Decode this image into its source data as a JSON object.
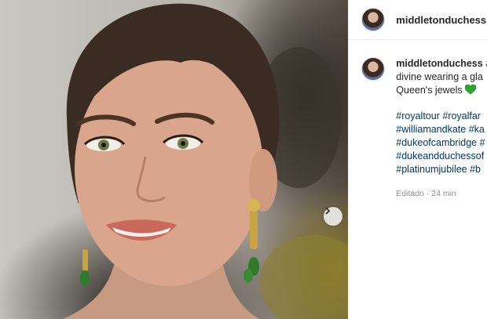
{
  "header": {
    "username": "middletonduchess"
  },
  "caption": {
    "username": "middletonduchess",
    "user_suffix": " #",
    "line1": "divine wearing a gla",
    "line2": "Queen's jewels",
    "emoji": "green-heart-icon",
    "hashtag_lines": [
      "#royaltour #royalfar",
      "#williamandkate #ka",
      "#dukeofcambridge #",
      "#dukeandduchessof",
      "#platinumjubilee #b"
    ]
  },
  "meta": {
    "edited": "Editado · 24 min"
  },
  "colors": {
    "link": "#00376b",
    "text": "#262626",
    "muted": "#8e8e8e",
    "heart": "#2ea62e"
  }
}
